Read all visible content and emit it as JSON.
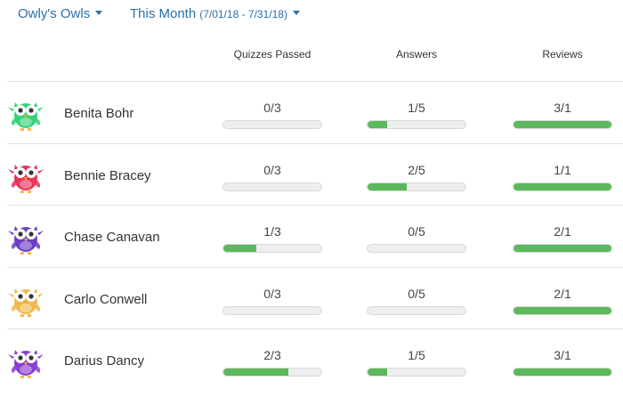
{
  "header": {
    "class_name": "Owly's Owls",
    "period_label": "This Month",
    "period_range": "(7/01/18 - 7/31/18)"
  },
  "columns": [
    "Quizzes Passed",
    "Answers",
    "Reviews"
  ],
  "colors": {
    "accent": "#2b6fa8",
    "progress_fill": "#5cb85c",
    "progress_track": "#eeeeee"
  },
  "students": [
    {
      "name": "Benita Bohr",
      "owl_color": "#34d17a",
      "owl_icon": "owl-green-icon",
      "quizzes": {
        "label": "0/3",
        "progress": 0
      },
      "answers": {
        "label": "1/5",
        "progress": 0.2
      },
      "reviews": {
        "label": "3/1",
        "progress": 1
      }
    },
    {
      "name": "Bennie Bracey",
      "owl_color": "#e8335a",
      "owl_icon": "owl-red-icon",
      "quizzes": {
        "label": "0/3",
        "progress": 0
      },
      "answers": {
        "label": "2/5",
        "progress": 0.4
      },
      "reviews": {
        "label": "1/1",
        "progress": 1
      }
    },
    {
      "name": "Chase Canavan",
      "owl_color": "#6a3fc8",
      "owl_icon": "owl-purple-icon",
      "quizzes": {
        "label": "1/3",
        "progress": 0.333
      },
      "answers": {
        "label": "0/5",
        "progress": 0
      },
      "reviews": {
        "label": "2/1",
        "progress": 1
      }
    },
    {
      "name": "Carlo Conwell",
      "owl_color": "#f2b84b",
      "owl_icon": "owl-orange-icon",
      "quizzes": {
        "label": "0/3",
        "progress": 0
      },
      "answers": {
        "label": "0/5",
        "progress": 0
      },
      "reviews": {
        "label": "2/1",
        "progress": 1
      }
    },
    {
      "name": "Darius Dancy",
      "owl_color": "#8a3fcf",
      "owl_icon": "owl-violet-icon",
      "quizzes": {
        "label": "2/3",
        "progress": 0.667
      },
      "answers": {
        "label": "1/5",
        "progress": 0.2
      },
      "reviews": {
        "label": "3/1",
        "progress": 1
      }
    }
  ]
}
